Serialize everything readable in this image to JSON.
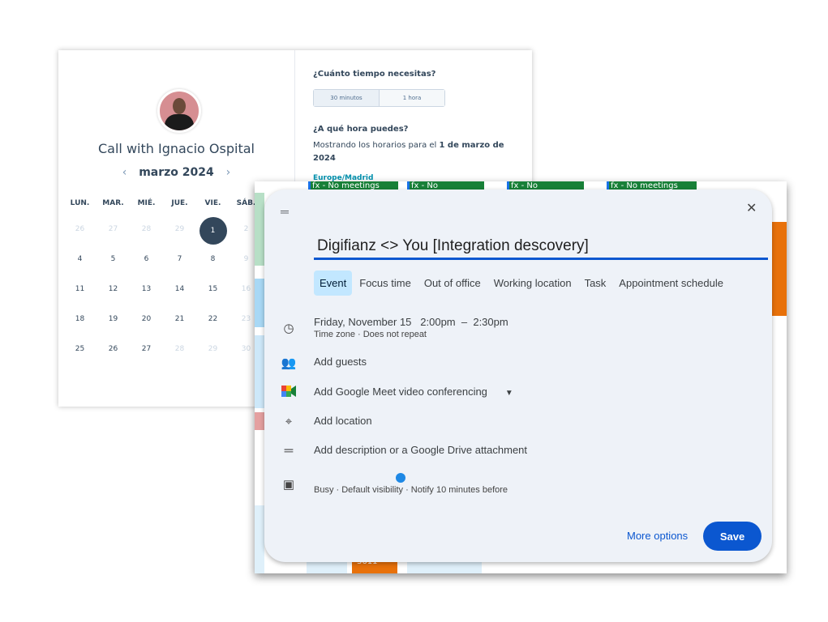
{
  "booking": {
    "title": "Call with Ignacio Ospital",
    "month": "marzo 2024",
    "prev": "‹",
    "next": "›",
    "weekdays": [
      "LUN.",
      "MAR.",
      "MIÉ.",
      "JUE.",
      "VIE.",
      "SÁB."
    ],
    "days": [
      {
        "n": "26",
        "state": "disabled"
      },
      {
        "n": "27",
        "state": "disabled"
      },
      {
        "n": "28",
        "state": "disabled"
      },
      {
        "n": "29",
        "state": "disabled"
      },
      {
        "n": "1",
        "state": "selected"
      },
      {
        "n": "2",
        "state": "disabled"
      },
      {
        "n": "4",
        "state": "enabled"
      },
      {
        "n": "5",
        "state": "enabled"
      },
      {
        "n": "6",
        "state": "enabled"
      },
      {
        "n": "7",
        "state": "enabled"
      },
      {
        "n": "8",
        "state": "enabled"
      },
      {
        "n": "9",
        "state": "disabled"
      },
      {
        "n": "11",
        "state": "enabled"
      },
      {
        "n": "12",
        "state": "enabled"
      },
      {
        "n": "13",
        "state": "enabled"
      },
      {
        "n": "14",
        "state": "enabled"
      },
      {
        "n": "15",
        "state": "enabled"
      },
      {
        "n": "16",
        "state": "disabled"
      },
      {
        "n": "18",
        "state": "enabled"
      },
      {
        "n": "19",
        "state": "enabled"
      },
      {
        "n": "20",
        "state": "enabled"
      },
      {
        "n": "21",
        "state": "enabled"
      },
      {
        "n": "22",
        "state": "enabled"
      },
      {
        "n": "23",
        "state": "disabled"
      },
      {
        "n": "25",
        "state": "enabled"
      },
      {
        "n": "26",
        "state": "enabled"
      },
      {
        "n": "27",
        "state": "enabled"
      },
      {
        "n": "28",
        "state": "disabled"
      },
      {
        "n": "29",
        "state": "disabled"
      },
      {
        "n": "30",
        "state": "disabled"
      }
    ],
    "duration_question": "¿Cuánto tiempo necesitas?",
    "duration_options": [
      "30 minutos",
      "1 hora"
    ],
    "time_question": "¿A qué hora puedes?",
    "showing_prefix": "Mostrando los horarios para el ",
    "showing_date": "1 de marzo de 2024",
    "timezone": "Europe/Madrid"
  },
  "background_calendar": {
    "chips": [
      "fx - No meetings",
      "fx - No",
      "fx - No",
      "fx - No meetings"
    ],
    "bottom_chip": "3611"
  },
  "dialog": {
    "title_value": "Digifianz <> You [Integration descovery]",
    "tabs": [
      "Event",
      "Focus time",
      "Out of office",
      "Working location",
      "Task",
      "Appointment schedule"
    ],
    "active_tab": "Event",
    "date": "Friday, November 15",
    "start": "2:00pm",
    "dash": "–",
    "end": "2:30pm",
    "time_sub": "Time zone · Does not repeat",
    "add_guests": "Add guests",
    "meet": "Add Google Meet video conferencing",
    "location": "Add location",
    "description": "Add description or a Google Drive attachment",
    "status_sub": "Busy · Default visibility · Notify 10 minutes before",
    "more_options": "More options",
    "save": "Save"
  },
  "colors": {
    "primary": "#0b57d0",
    "selected_tab": "#c2e7ff",
    "chip_green": "#188038",
    "orange": "#e8710a",
    "booking_text": "#33475b"
  }
}
